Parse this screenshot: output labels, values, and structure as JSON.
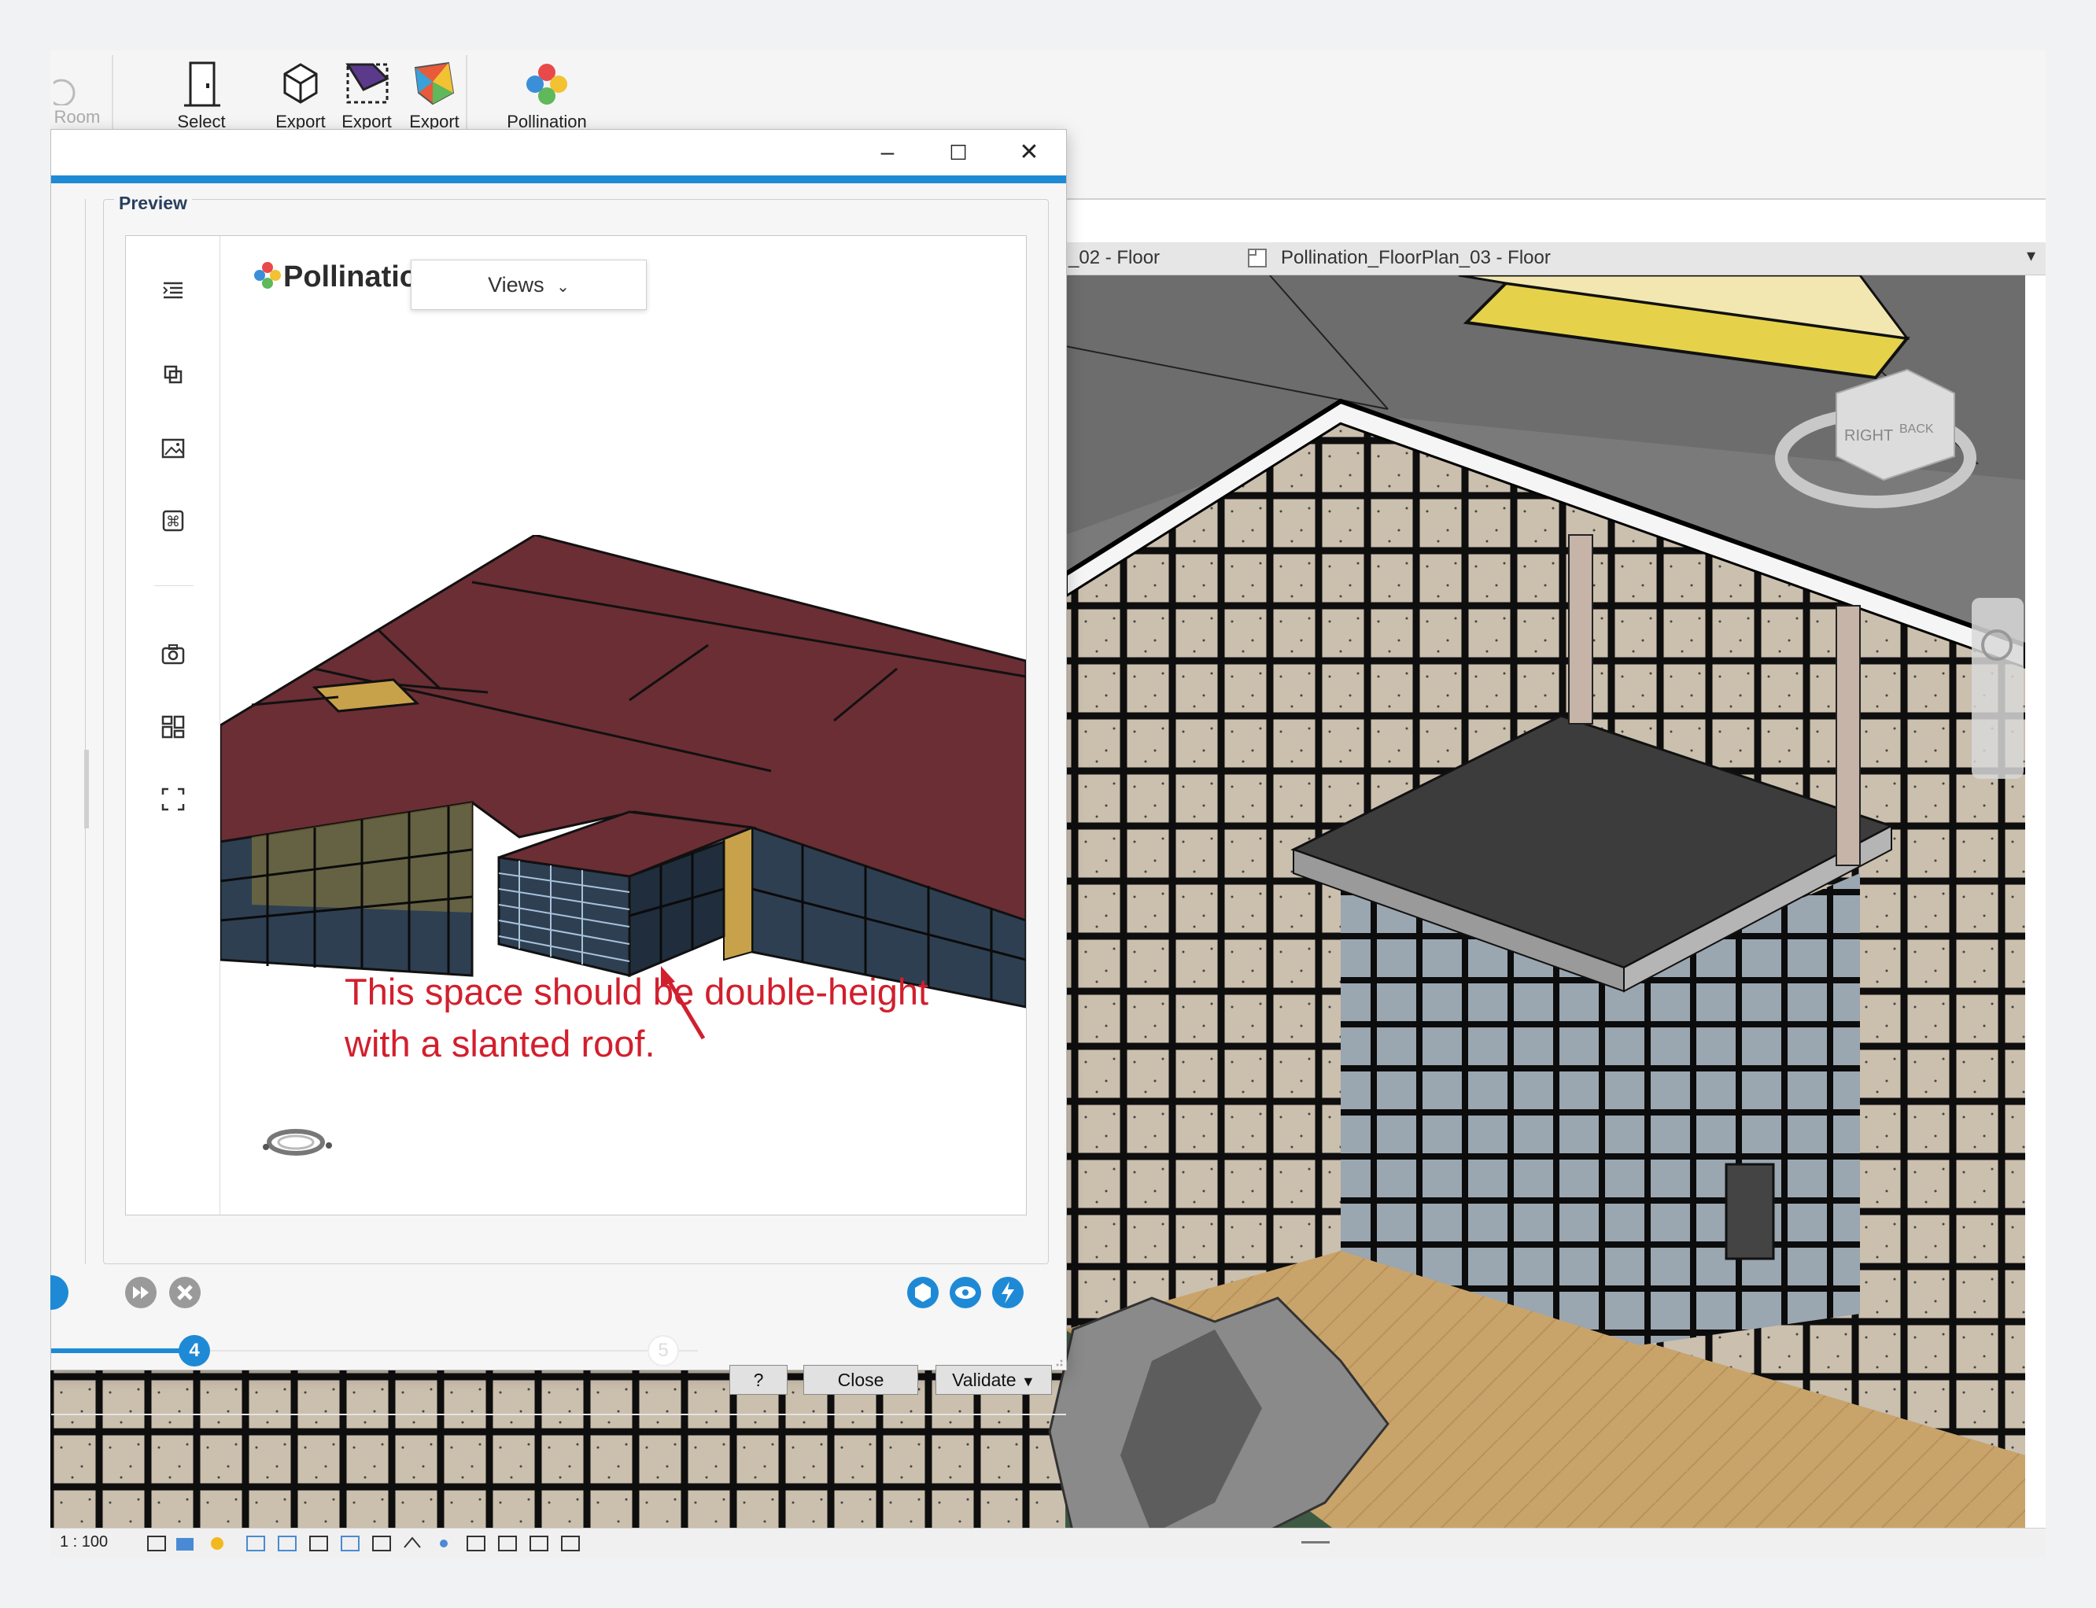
{
  "ribbon": {
    "room_label": "Room",
    "select_label": "Select",
    "export1_label": "Export",
    "export2_label": "Export",
    "export3_label": "Export",
    "pollination_label": "Pollination"
  },
  "tabs": {
    "floor02": "_02 - Floor",
    "floor03": "Pollination_FloorPlan_03 - Floor"
  },
  "viewcube": {
    "right": "RIGHT",
    "back": "BACK"
  },
  "dialog": {
    "minimize": "–",
    "maximize": "☐",
    "close": "✕",
    "preview_legend": "Preview",
    "brand": "Pollination",
    "views_button": "Views",
    "annotation_line1": "This space should be double-height",
    "annotation_line2": "with a slanted roof.",
    "step_current": "4",
    "step_next": "5",
    "help_button": "?",
    "close_button": "Close",
    "validate_button": "Validate"
  },
  "statusbar": {
    "scale": "1 : 100"
  },
  "colors": {
    "accent_blue": "#1e8ad6",
    "annotation_red": "#d21f2d",
    "roof_maroon": "#6b2e35",
    "glass_dark": "#2e3f52"
  }
}
